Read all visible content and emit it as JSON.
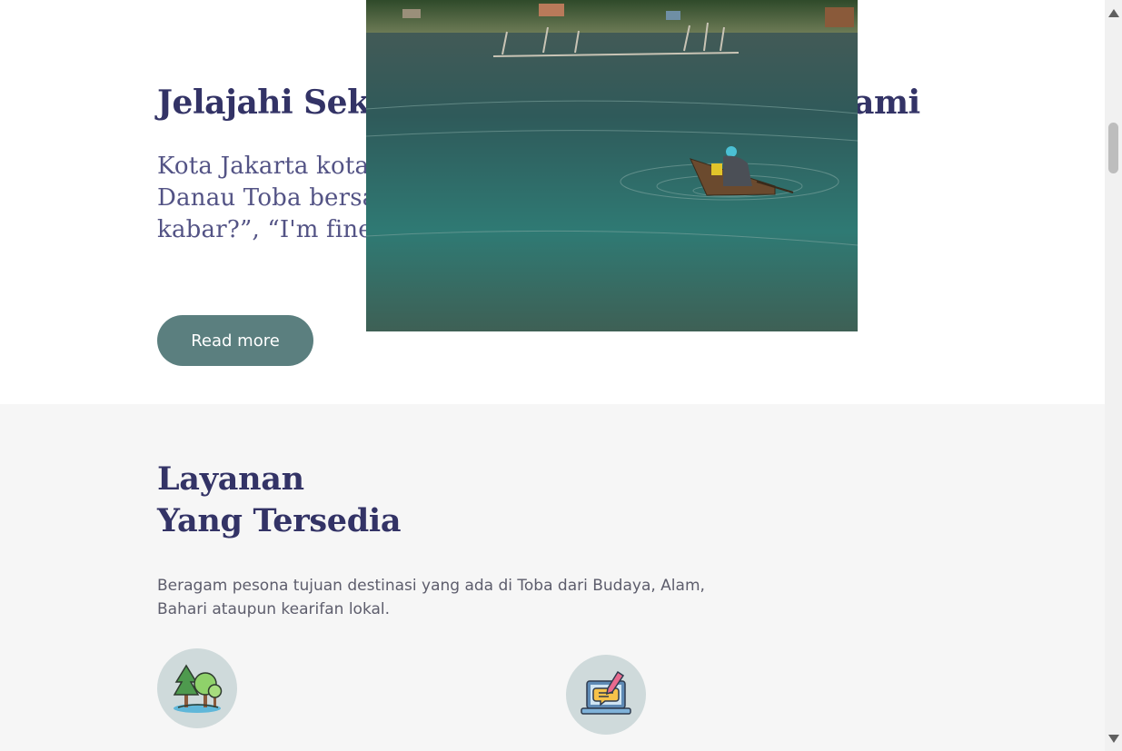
{
  "hero": {
    "title": "Jelajahi Sekitar Danau Toba bersama kami",
    "description": "Kota Jakarta kota yang penuh sesak, Surga impian pasti Danau Toba bersama kami. Kusapa “Horas amang! Apa kabar?”, “I'm fine, thank you”",
    "read_more_label": "Read more"
  },
  "modal": {
    "image_alt": "Fisherman in a wooden boat on Lake Toba"
  },
  "services": {
    "title_line1": "Layanan",
    "title_line2": "Yang Tersedia",
    "description": "Beragam pesona tujuan destinasi yang ada di Toba dari Budaya, Alam, Bahari ataupun kearifan lokal.",
    "icons": [
      "nature-trees-icon",
      "online-booking-laptop-icon"
    ]
  },
  "colors": {
    "heading": "#333366",
    "button": "#5b7f7f",
    "section_bg": "#f6f6f6",
    "icon_circle": "#cfdadb"
  }
}
